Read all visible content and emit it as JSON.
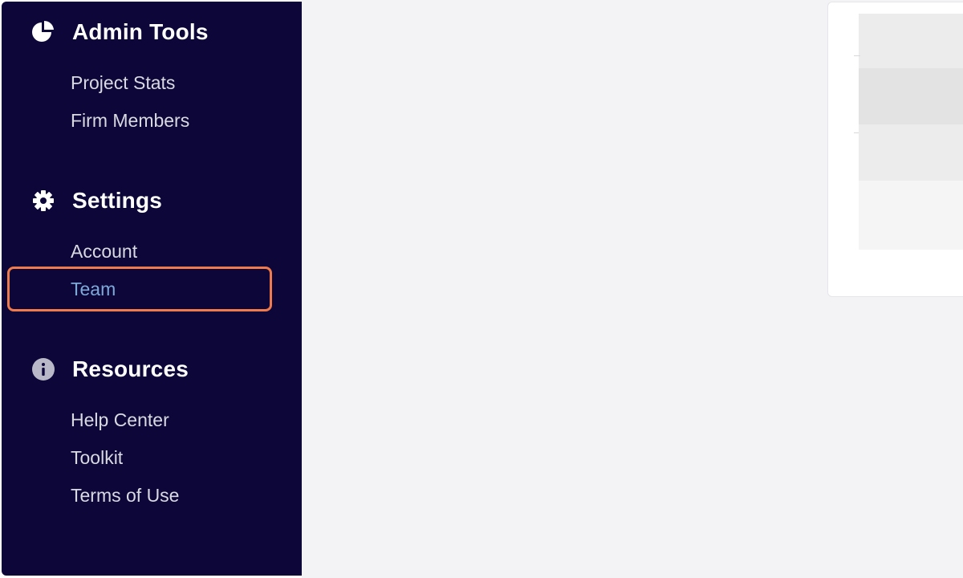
{
  "sidebar": {
    "sections": [
      {
        "title": "Admin Tools",
        "icon": "pie-chart-icon",
        "items": [
          {
            "label": "Project Stats"
          },
          {
            "label": "Firm Members"
          }
        ]
      },
      {
        "title": "Settings",
        "icon": "gear-icon",
        "items": [
          {
            "label": "Account"
          },
          {
            "label": "Team",
            "active": true
          }
        ]
      },
      {
        "title": "Resources",
        "icon": "info-icon",
        "items": [
          {
            "label": "Help Center"
          },
          {
            "label": "Toolkit"
          },
          {
            "label": "Terms of Use"
          }
        ]
      }
    ]
  },
  "colors": {
    "sidebar_bg": "#0c0639",
    "active_item": "#7fa9d9",
    "highlight": "#ef7a4c",
    "main_bg": "#f3f3f5"
  }
}
